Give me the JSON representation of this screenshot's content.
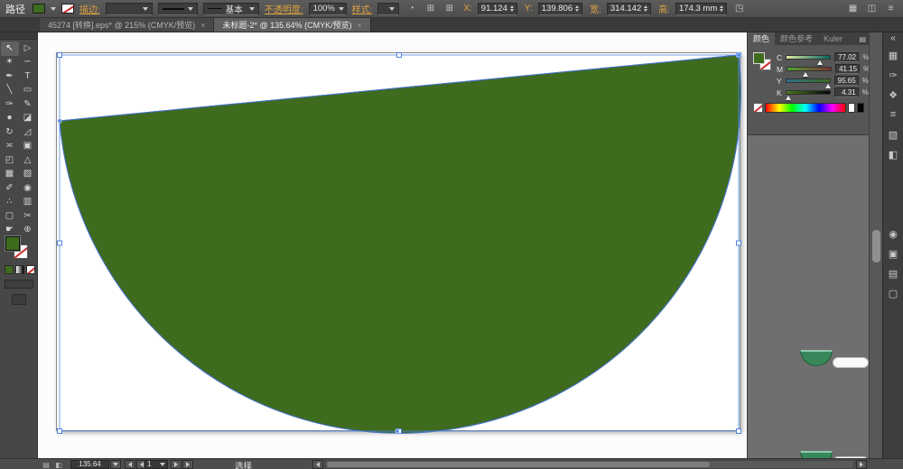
{
  "control_bar": {
    "object_label": "路径",
    "stroke_label": "描边:",
    "brush_value": "基本",
    "opacity_label": "不透明度:",
    "opacity_value": "100%",
    "style_label": "样式:",
    "transform": {
      "x_label": "X:",
      "x_value": "91.124",
      "y_label": "Y:",
      "y_value": "139.806",
      "w_label": "宽:",
      "w_value": "314.142",
      "h_label": "高:",
      "h_value": "174.3 mm"
    },
    "icons": {
      "recolor": "◔",
      "align_grid_1": "⊞",
      "align_grid_2": "⊞",
      "transform_panel": "◳",
      "arrange_documents": "▦",
      "workspace_switcher": "◫",
      "app_menu": "≡"
    }
  },
  "tab_bar": {
    "tabs": [
      {
        "label": "45274 [转换].eps* @ 215% (CMYK/预览)",
        "close": "×"
      },
      {
        "label": "未标题-2* @ 135.64% (CMYK/预览)",
        "close": "×"
      }
    ]
  },
  "tools": [
    {
      "name": "selection",
      "glyph": "↖"
    },
    {
      "name": "direct-selection",
      "glyph": "▷"
    },
    {
      "name": "magic-wand",
      "glyph": "✶"
    },
    {
      "name": "lasso",
      "glyph": "∽"
    },
    {
      "name": "pen",
      "glyph": "✒"
    },
    {
      "name": "type",
      "glyph": "T"
    },
    {
      "name": "line-segment",
      "glyph": "╲"
    },
    {
      "name": "rectangle",
      "glyph": "▭"
    },
    {
      "name": "paintbrush",
      "glyph": "✑"
    },
    {
      "name": "pencil",
      "glyph": "✎"
    },
    {
      "name": "blob-brush",
      "glyph": "●"
    },
    {
      "name": "eraser",
      "glyph": "◪"
    },
    {
      "name": "rotate",
      "glyph": "↻"
    },
    {
      "name": "scale",
      "glyph": "◿"
    },
    {
      "name": "width",
      "glyph": "≍"
    },
    {
      "name": "free-transform",
      "glyph": "▣"
    },
    {
      "name": "shape-builder",
      "glyph": "◰"
    },
    {
      "name": "perspective-grid",
      "glyph": "△"
    },
    {
      "name": "mesh",
      "glyph": "▦"
    },
    {
      "name": "gradient",
      "glyph": "▨"
    },
    {
      "name": "eyedropper",
      "glyph": "✐"
    },
    {
      "name": "blend",
      "glyph": "◉"
    },
    {
      "name": "symbol-sprayer",
      "glyph": "∴"
    },
    {
      "name": "column-graph",
      "glyph": "▥"
    },
    {
      "name": "artboard",
      "glyph": "▢"
    },
    {
      "name": "slice",
      "glyph": "✂"
    },
    {
      "name": "hand",
      "glyph": "☛"
    },
    {
      "name": "zoom",
      "glyph": "⊕"
    }
  ],
  "canvas": {
    "shape_fill": "#3e6b1e",
    "shape_stroke": "#203a63",
    "selection_color": "#4f83e0"
  },
  "color_panel": {
    "tabs": [
      {
        "label": "颜色"
      },
      {
        "label": "颜色参考"
      },
      {
        "label": "Kuler"
      }
    ],
    "panel_menu_icon": "▤",
    "sliders": [
      {
        "channel": "C",
        "value": "77.02",
        "unit": "%",
        "pos": 77
      },
      {
        "channel": "M",
        "value": "41.15",
        "unit": "%",
        "pos": 41
      },
      {
        "channel": "Y",
        "value": "95.65",
        "unit": "%",
        "pos": 96
      },
      {
        "channel": "K",
        "value": "4.31",
        "unit": "%",
        "pos": 4
      }
    ]
  },
  "collapsed_panels": {
    "expand_icon": "«",
    "icons": [
      {
        "name": "swatches",
        "glyph": "▦"
      },
      {
        "name": "brushes",
        "glyph": "✑"
      },
      {
        "name": "symbols",
        "glyph": "❖"
      },
      {
        "name": "stroke",
        "glyph": "≡"
      },
      {
        "name": "gradient",
        "glyph": "▨"
      },
      {
        "name": "transparency",
        "glyph": "◧"
      },
      {
        "name": "appearance",
        "glyph": "◉",
        "gap_before": true
      },
      {
        "name": "graphic-styles",
        "glyph": "▣"
      },
      {
        "name": "layers",
        "glyph": "▤"
      },
      {
        "name": "artboards",
        "glyph": "▢"
      }
    ]
  },
  "status_bar": {
    "zoom_value": "135.64",
    "artboard_value": "1",
    "status_label": "选择",
    "icons": {
      "left_1": "▤",
      "left_2": "◧"
    }
  }
}
